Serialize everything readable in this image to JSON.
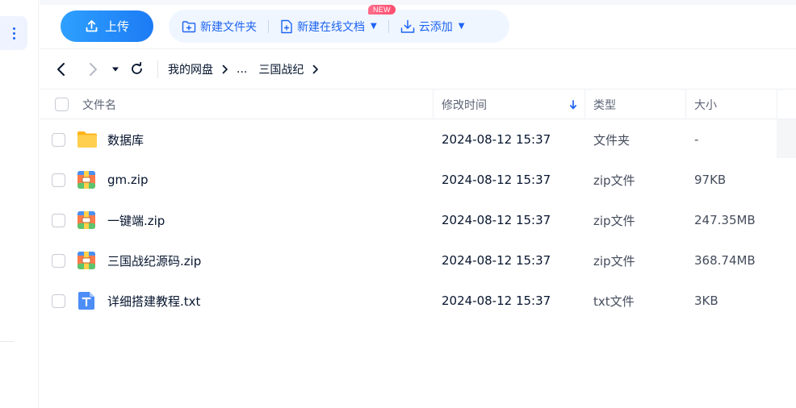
{
  "toolbar": {
    "upload_label": "上传",
    "new_folder_label": "新建文件夹",
    "new_online_doc_label": "新建在线文档",
    "new_badge": "NEW",
    "cloud_add_label": "云添加"
  },
  "breadcrumb": {
    "items": [
      "我的网盘",
      "...",
      "三国战纪"
    ]
  },
  "table": {
    "headers": {
      "name": "文件名",
      "modified": "修改时间",
      "type": "类型",
      "size": "大小"
    },
    "rows": [
      {
        "name": "数据库",
        "modified": "2024-08-12 15:37",
        "type": "文件夹",
        "size": "-",
        "icon": "folder-icon"
      },
      {
        "name": "gm.zip",
        "modified": "2024-08-12 15:37",
        "type": "zip文件",
        "size": "97KB",
        "icon": "zip-icon"
      },
      {
        "name": "一键端.zip",
        "modified": "2024-08-12 15:37",
        "type": "zip文件",
        "size": "247.35MB",
        "icon": "zip-icon"
      },
      {
        "name": "三国战纪源码.zip",
        "modified": "2024-08-12 15:37",
        "type": "zip文件",
        "size": "368.74MB",
        "icon": "zip-icon"
      },
      {
        "name": "详细搭建教程.txt",
        "modified": "2024-08-12 15:37",
        "type": "txt文件",
        "size": "3KB",
        "icon": "txt-icon"
      }
    ]
  },
  "colors": {
    "accent": "#1d64f2",
    "upload_gradient_start": "#2ea0ff",
    "upload_gradient_end": "#1c7bf4",
    "badge": "#ff4d6d",
    "folder": "#ffc53d",
    "txt_icon": "#4c8df6"
  }
}
